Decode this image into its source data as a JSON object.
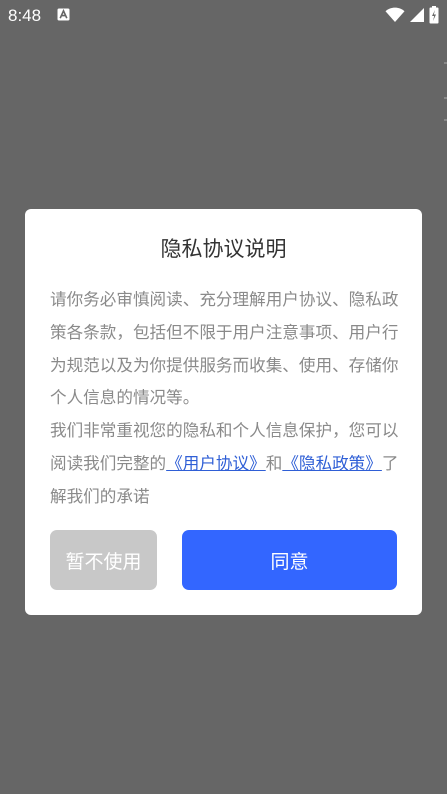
{
  "status_bar": {
    "time": "8:48",
    "app_icon": "a-letter-icon",
    "icons": [
      "wifi-icon",
      "cellular-signal-icon",
      "battery-icon"
    ]
  },
  "dialog": {
    "title": "隐私协议说明",
    "paragraph1": "请你务必审慎阅读、充分理解用户协议、隐私政策各条款，包括但不限于用户注意事项、用户行为规范以及为你提供服务而收集、使用、存储你个人信息的情况等。",
    "paragraph2_prefix": "我们非常重视您的隐私和个人信息保护，您可以阅读我们完整的",
    "user_agreement_link": "《用户协议》",
    "conjunction": "和",
    "privacy_policy_link": "《隐私政策》",
    "paragraph2_suffix": "了解我们的承诺",
    "decline_label": "暂不使用",
    "agree_label": "同意"
  },
  "colors": {
    "overlay": "#666666",
    "link": "#2f5fd6",
    "agree_button": "#3366ff",
    "decline_button": "#c8c8c8"
  }
}
